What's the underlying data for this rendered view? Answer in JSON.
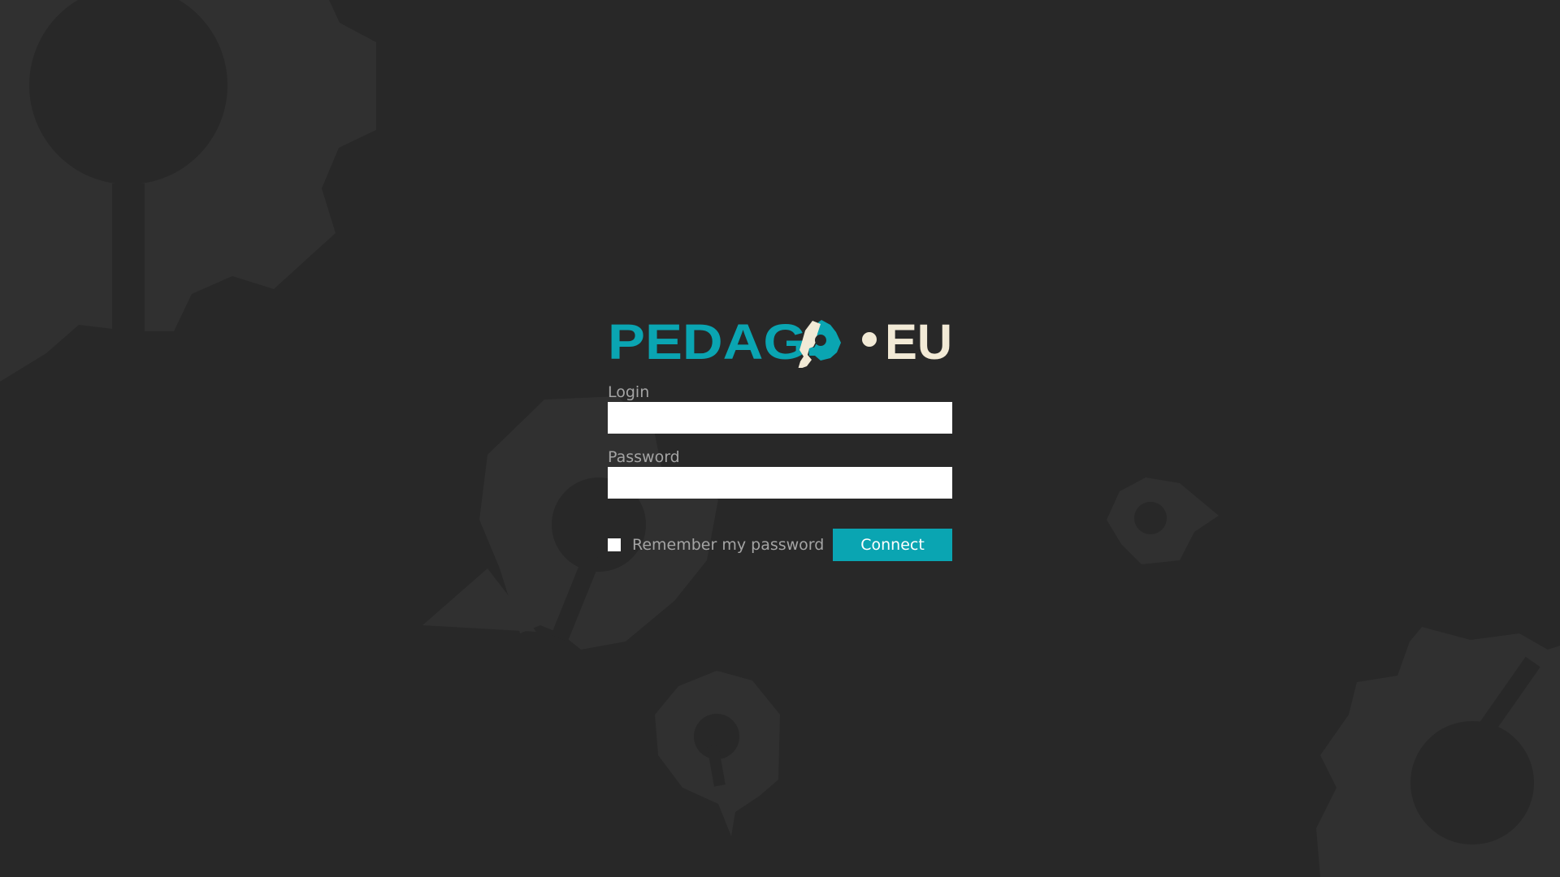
{
  "logo": {
    "part1": "PEDAG",
    "part2": "EU",
    "alt": "PEDAGO.EU",
    "teal": "#0aa5b2",
    "cream": "#f2ead6"
  },
  "login": {
    "label": "Login",
    "value": "",
    "placeholder": ""
  },
  "password": {
    "label": "Password",
    "value": "",
    "placeholder": ""
  },
  "remember": {
    "label": "Remember my password",
    "checked": false
  },
  "connect": {
    "label": "Connect"
  },
  "colors": {
    "background": "#282828",
    "decoration": "#303030",
    "accent": "#0aa5b2",
    "label": "#a4a4a4"
  }
}
